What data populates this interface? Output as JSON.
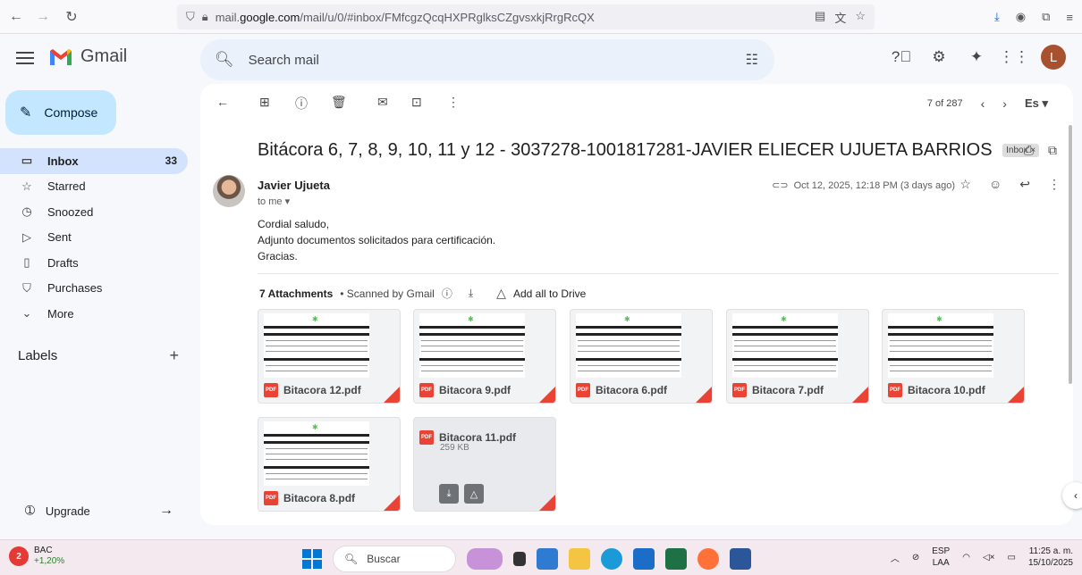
{
  "browser": {
    "url_prefix": "mail.",
    "url_domain": "google.com",
    "url_path": "/mail/u/0/#inbox/FMfcgzQcqHXPRglksCZgvsxkjRrgRcQX"
  },
  "header": {
    "logo_text": "Gmail",
    "search_placeholder": "Search mail",
    "avatar_letter": "L"
  },
  "sidebar": {
    "compose_label": "Compose",
    "items": [
      {
        "label": "Inbox",
        "icon": "inbox-icon",
        "count": "33"
      },
      {
        "label": "Starred",
        "icon": "star-icon"
      },
      {
        "label": "Snoozed",
        "icon": "clock-icon"
      },
      {
        "label": "Sent",
        "icon": "send-icon"
      },
      {
        "label": "Drafts",
        "icon": "draft-icon"
      },
      {
        "label": "Purchases",
        "icon": "tag-icon"
      },
      {
        "label": "More",
        "icon": "chevron-down-icon"
      }
    ],
    "labels_title": "Labels",
    "upgrade_label": "Upgrade"
  },
  "toolbar": {
    "pagination": "7 of 287",
    "lang": "Es"
  },
  "email": {
    "subject": "Bitácora 6, 7, 8, 9, 10, 11 y 12 - 3037278-1001817281-JAVIER ELIECER UJUETA BARRIOS",
    "label_chip": "Inbox ×",
    "sender": "Javier Ujueta",
    "to": "to me ▾",
    "date": "Oct 12, 2025, 12:18 PM (3 days ago)",
    "body": [
      "Cordial saludo,",
      "Adjunto documentos solicitados para certificación.",
      "Gracias."
    ],
    "attachments_title": "7 Attachments",
    "scanned_text": "• Scanned by Gmail",
    "add_drive": "Add all to Drive",
    "attachments": [
      {
        "name": "Bitacora 12.pdf"
      },
      {
        "name": "Bitacora 9.pdf"
      },
      {
        "name": "Bitacora 6.pdf"
      },
      {
        "name": "Bitacora 7.pdf"
      },
      {
        "name": "Bitacora 10.pdf"
      },
      {
        "name": "Bitacora 8.pdf"
      },
      {
        "name": "Bitacora 11.pdf",
        "size": "259 KB"
      }
    ]
  },
  "taskbar": {
    "stock_name": "BAC",
    "stock_change": "+1,20%",
    "stock_badge": "2",
    "search_label": "Buscar",
    "lang_top": "ESP",
    "lang_bottom": "LAA",
    "time": "11:25 a. m.",
    "date": "15/10/2025"
  },
  "colors": {
    "compose_bg": "#c2e7ff",
    "active_bg": "#d3e3fd",
    "pdf_red": "#ea4335"
  }
}
